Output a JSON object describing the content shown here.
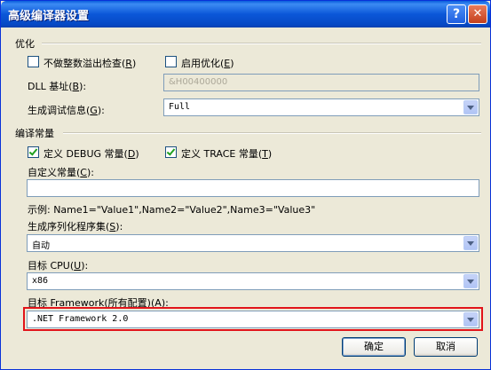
{
  "window": {
    "title": "高级编译器设置",
    "help_label": "?",
    "close_label": "✕"
  },
  "optimize": {
    "section_label": "优化",
    "overflow_check": {
      "label": "不做整数溢出检查",
      "mnemonic": "R",
      "checked": false
    },
    "enable_opt": {
      "label": "启用优化",
      "mnemonic": "E",
      "checked": false
    },
    "dll_base": {
      "label": "DLL 基址",
      "mnemonic": "B",
      "value": "&H00400000"
    },
    "debug_info": {
      "label": "生成调试信息",
      "mnemonic": "G",
      "value": "Full"
    }
  },
  "compile_constants": {
    "section_label": "编译常量",
    "define_debug": {
      "label": "定义 DEBUG 常量",
      "mnemonic": "D",
      "checked": true
    },
    "define_trace": {
      "label": "定义 TRACE 常量",
      "mnemonic": "T",
      "checked": true
    },
    "custom_constants": {
      "label": "自定义常量",
      "mnemonic": "C",
      "value": ""
    },
    "example_text": "示例: Name1=\"Value1\",Name2=\"Value2\",Name3=\"Value3\""
  },
  "serialization": {
    "label": "生成序列化程序集",
    "mnemonic": "S",
    "value": "自动"
  },
  "target_cpu": {
    "label": "目标 CPU",
    "mnemonic": "U",
    "value": "x86"
  },
  "target_framework": {
    "label": "目标 Framework(所有配置)",
    "mnemonic": "A",
    "value": ".NET Framework 2.0"
  },
  "buttons": {
    "ok": "确定",
    "cancel": "取消"
  },
  "colors": {
    "highlight": "#e2141a",
    "titlebar": "#0a5ddc"
  }
}
